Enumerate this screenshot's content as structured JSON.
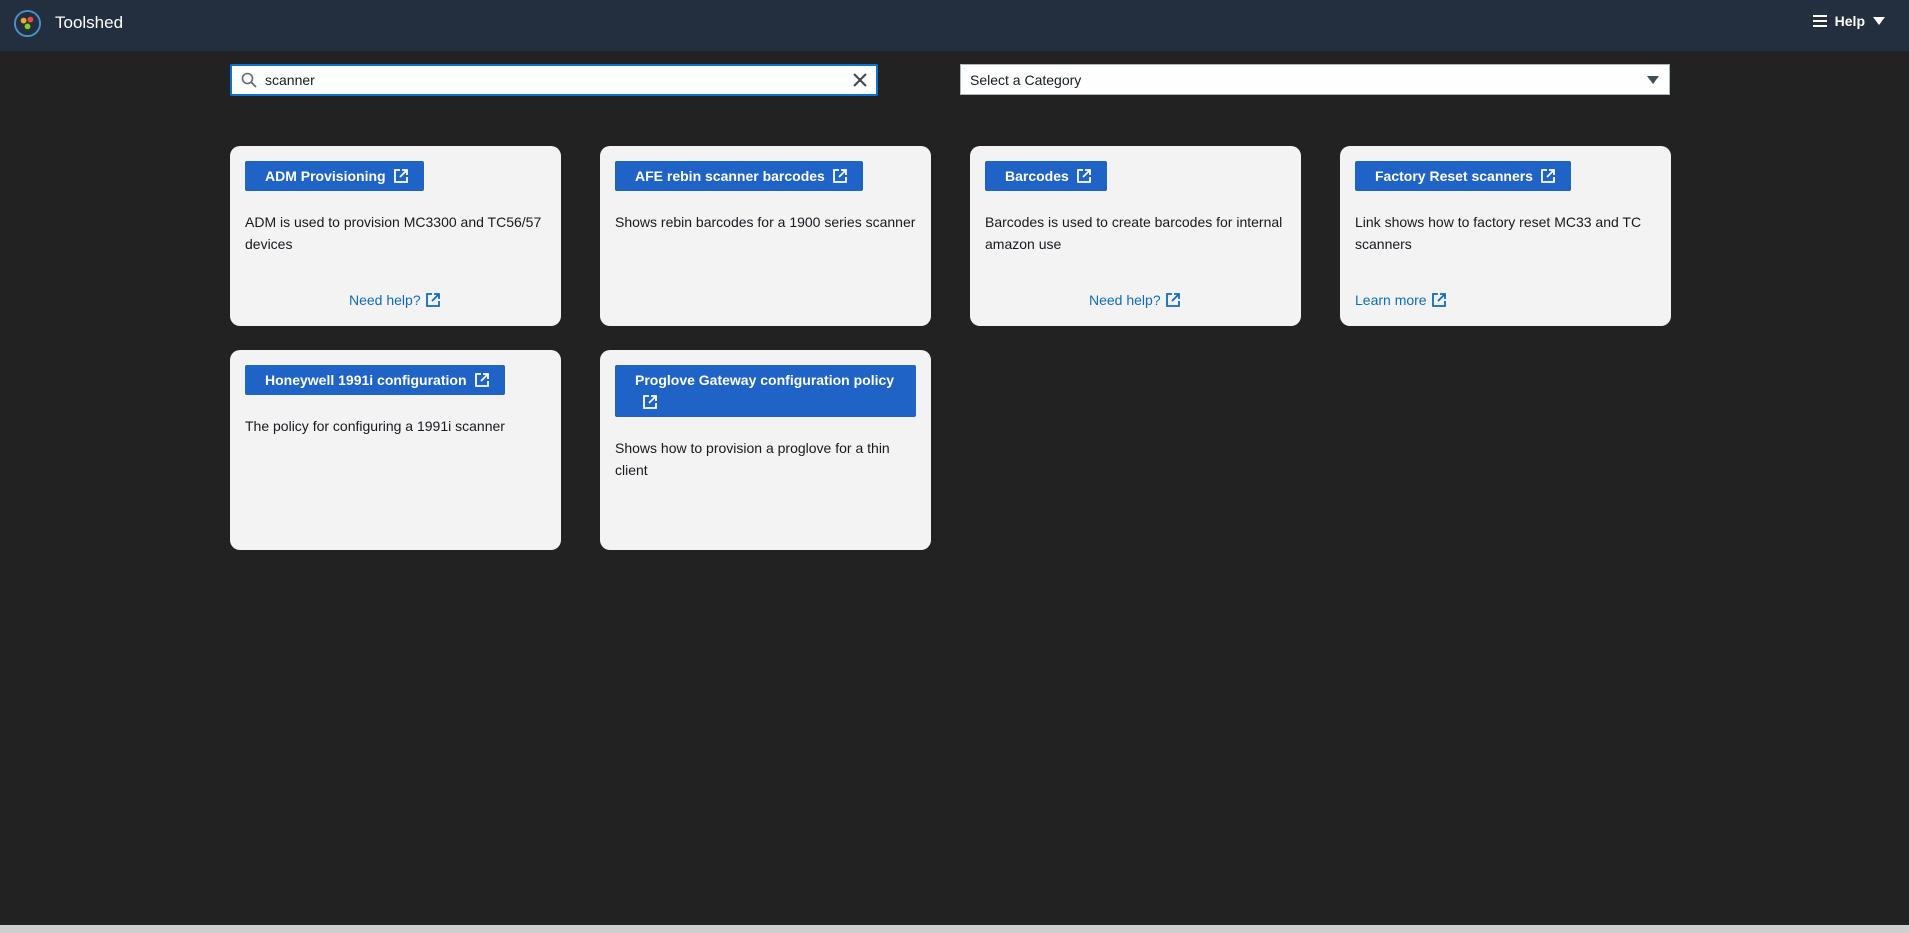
{
  "header": {
    "title": "Toolshed",
    "help_label": "Help",
    "logo_icon": "toolshed-logo-icon"
  },
  "search": {
    "value": "scanner",
    "placeholder": ""
  },
  "category_select": {
    "selected": "Select a Category"
  },
  "cards": [
    {
      "button_label": "ADM Provisioning",
      "description": "ADM is used to provision MC3300 and TC56/57 devices",
      "link_label": "Need help?"
    },
    {
      "button_label": "AFE rebin scanner barcodes",
      "description": "Shows rebin barcodes for a 1900 series scanner",
      "link_label": ""
    },
    {
      "button_label": "Barcodes",
      "description": "Barcodes is used to create barcodes for internal amazon use",
      "link_label": "Need help?"
    },
    {
      "button_label": "Factory Reset scanners",
      "description": "Link shows how to factory reset MC33 and TC scanners",
      "link_label": "Learn more"
    },
    {
      "button_label": "Honeywell 1991i configuration",
      "description": "The policy for configuring a 1991i scanner",
      "link_label": ""
    },
    {
      "button_label": "Proglove Gateway configuration policy",
      "description": "Shows how to provision a proglove for a thin client",
      "link_label": ""
    }
  ],
  "colors": {
    "header_bg": "#232f3e",
    "page_bg": "#222222",
    "card_bg": "#f3f3f3",
    "button_bg": "#1f63c6",
    "link": "#0f6cbd",
    "focus_border": "#0972d3"
  }
}
